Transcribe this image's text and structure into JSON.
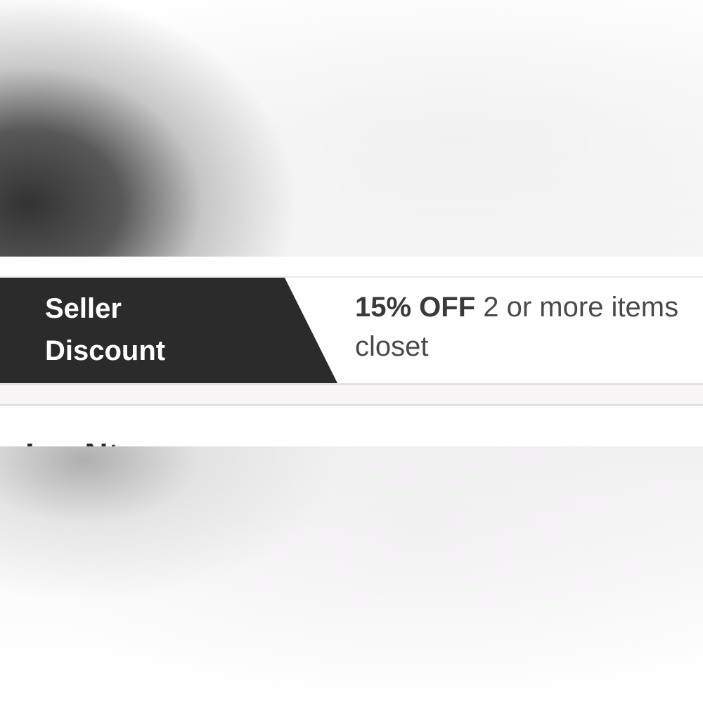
{
  "discount": {
    "tag_line1": "Seller",
    "tag_line2": "Discount",
    "amount": "15% OFF",
    "description_part1": " 2 or more items",
    "description_part2": "closet"
  },
  "notes": {
    "heading": "Lar Nt"
  },
  "colors": {
    "tag_background": "#2b2b2b",
    "tag_text": "#ffffff",
    "body_text": "#4a4a4a"
  }
}
